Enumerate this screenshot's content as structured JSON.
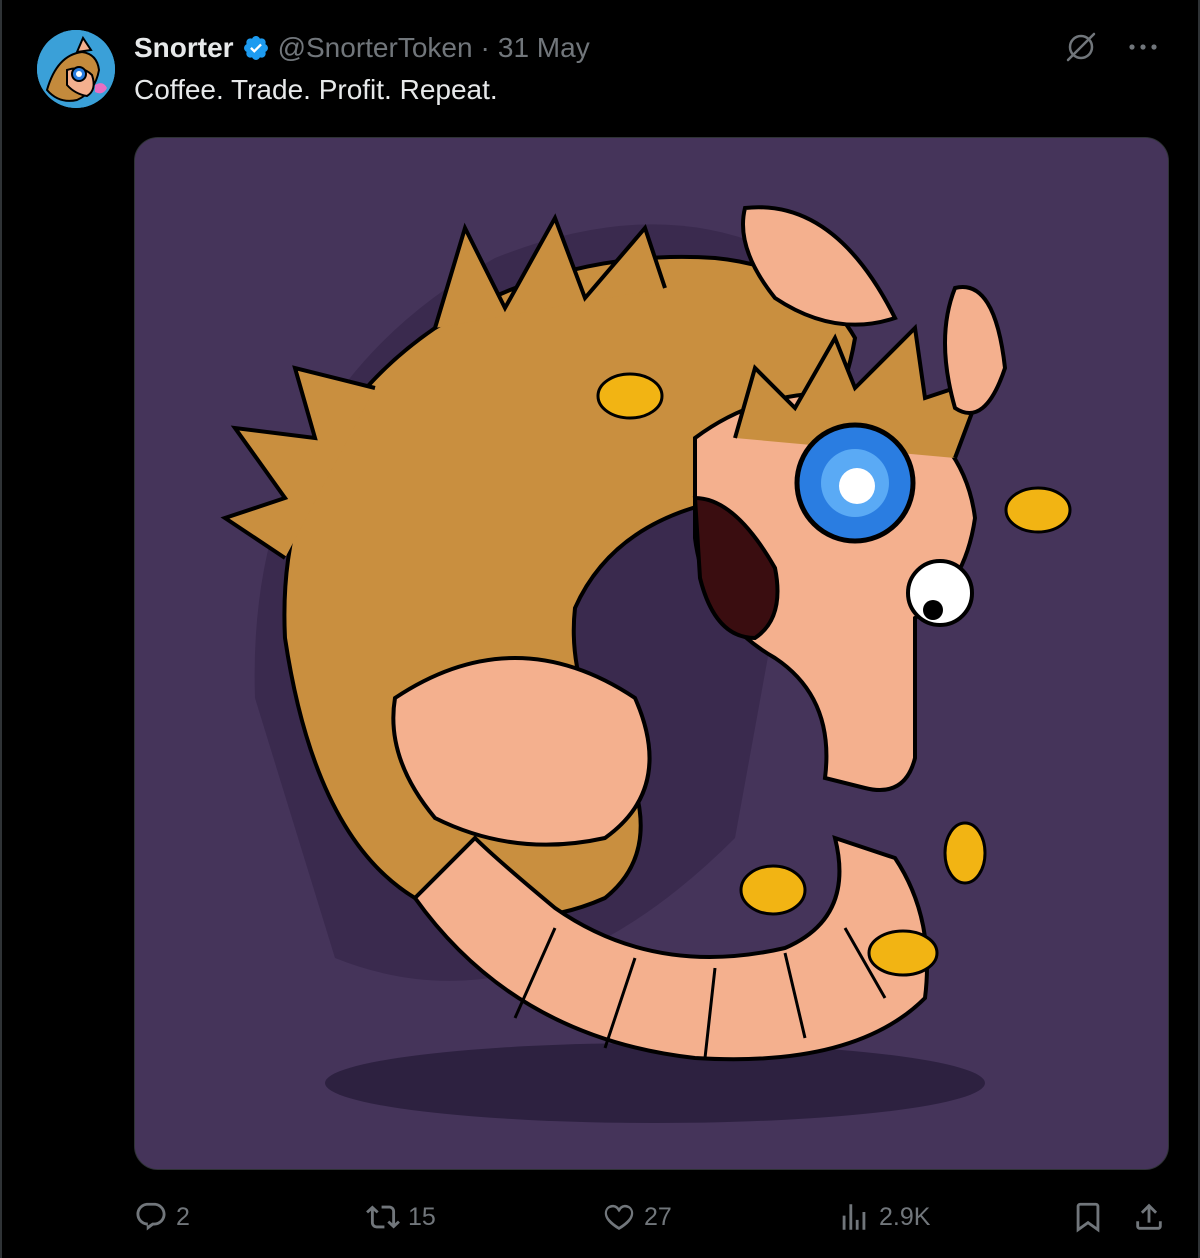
{
  "tweet": {
    "author_name": "Snorter",
    "handle": "@SnorterToken",
    "separator": "·",
    "date": "31 May",
    "text": "Coffee. Trade. Profit. Repeat.",
    "verified": true
  },
  "top_icons": [
    "grok-icon",
    "more-icon"
  ],
  "actions": {
    "replies": "2",
    "reposts": "15",
    "likes": "27",
    "views": "2.9K"
  },
  "colors": {
    "background": "#000000",
    "media_background": "#45345a",
    "verified_blue": "#1d9bf0",
    "muted": "#71767b",
    "text": "#e7e9ea"
  }
}
